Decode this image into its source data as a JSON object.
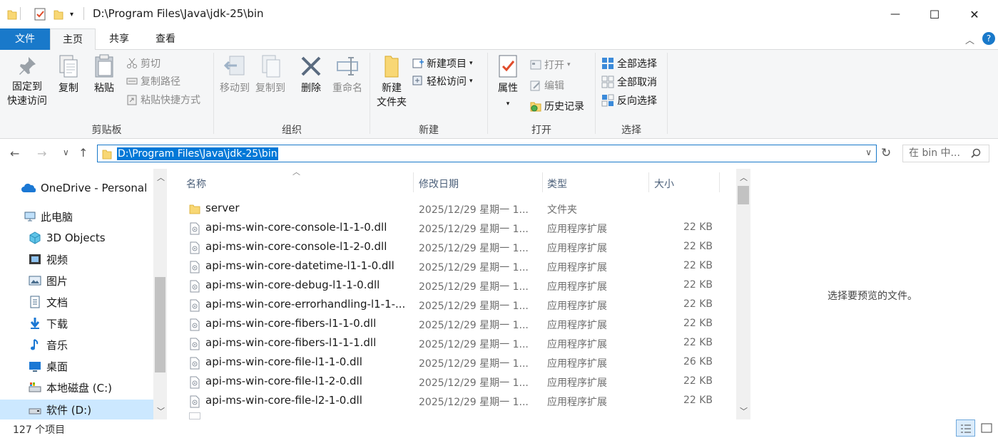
{
  "window": {
    "title": "D:\\Program Files\\Java\\jdk-25\\bin",
    "minimize": "—",
    "maximize": "☐",
    "close": "✕"
  },
  "tabs": {
    "file": "文件",
    "home": "主页",
    "share": "共享",
    "view": "查看"
  },
  "ribbon": {
    "clipboard": {
      "label": "剪贴板",
      "pin": "固定到\n快速访问",
      "pin_line1": "固定到",
      "pin_line2": "快速访问",
      "copy": "复制",
      "paste": "粘贴",
      "cut": "剪切",
      "copy_path": "复制路径",
      "paste_shortcut": "粘贴快捷方式"
    },
    "organize": {
      "label": "组织",
      "move_to": "移动到",
      "copy_to": "复制到",
      "delete": "删除",
      "rename": "重命名"
    },
    "new": {
      "label": "新建",
      "new_folder_line1": "新建",
      "new_folder_line2": "文件夹",
      "new_item": "新建项目",
      "easy_access": "轻松访问"
    },
    "open": {
      "label": "打开",
      "properties": "属性",
      "open": "打开",
      "edit": "编辑",
      "history": "历史记录"
    },
    "select": {
      "label": "选择",
      "select_all": "全部选择",
      "select_none": "全部取消",
      "invert": "反向选择"
    }
  },
  "address": {
    "path": "D:\\Program Files\\Java\\jdk-25\\bin",
    "search_placeholder": "在 bin 中..."
  },
  "sidebar": {
    "items": [
      {
        "label": "OneDrive - Personal",
        "icon": "onedrive-icon"
      },
      {
        "label": "此电脑",
        "icon": "computer-icon"
      },
      {
        "label": "3D Objects",
        "icon": "3d-objects-icon"
      },
      {
        "label": "视频",
        "icon": "video-icon"
      },
      {
        "label": "图片",
        "icon": "pictures-icon"
      },
      {
        "label": "文档",
        "icon": "documents-icon"
      },
      {
        "label": "下载",
        "icon": "download-icon"
      },
      {
        "label": "音乐",
        "icon": "music-icon"
      },
      {
        "label": "桌面",
        "icon": "desktop-icon"
      },
      {
        "label": "本地磁盘 (C:)",
        "icon": "drive-c-icon"
      },
      {
        "label": "软件 (D:)",
        "icon": "drive-d-icon"
      }
    ]
  },
  "columns": {
    "name": "名称",
    "date": "修改日期",
    "type": "类型",
    "size": "大小"
  },
  "files": [
    {
      "name": "server",
      "date": "2025/12/29 星期一 1...",
      "type": "文件夹",
      "size": "",
      "kind": "folder"
    },
    {
      "name": "api-ms-win-core-console-l1-1-0.dll",
      "date": "2025/12/29 星期一 1...",
      "type": "应用程序扩展",
      "size": "22 KB",
      "kind": "dll"
    },
    {
      "name": "api-ms-win-core-console-l1-2-0.dll",
      "date": "2025/12/29 星期一 1...",
      "type": "应用程序扩展",
      "size": "22 KB",
      "kind": "dll"
    },
    {
      "name": "api-ms-win-core-datetime-l1-1-0.dll",
      "date": "2025/12/29 星期一 1...",
      "type": "应用程序扩展",
      "size": "22 KB",
      "kind": "dll"
    },
    {
      "name": "api-ms-win-core-debug-l1-1-0.dll",
      "date": "2025/12/29 星期一 1...",
      "type": "应用程序扩展",
      "size": "22 KB",
      "kind": "dll"
    },
    {
      "name": "api-ms-win-core-errorhandling-l1-1-...",
      "date": "2025/12/29 星期一 1...",
      "type": "应用程序扩展",
      "size": "22 KB",
      "kind": "dll"
    },
    {
      "name": "api-ms-win-core-fibers-l1-1-0.dll",
      "date": "2025/12/29 星期一 1...",
      "type": "应用程序扩展",
      "size": "22 KB",
      "kind": "dll"
    },
    {
      "name": "api-ms-win-core-fibers-l1-1-1.dll",
      "date": "2025/12/29 星期一 1...",
      "type": "应用程序扩展",
      "size": "22 KB",
      "kind": "dll"
    },
    {
      "name": "api-ms-win-core-file-l1-1-0.dll",
      "date": "2025/12/29 星期一 1...",
      "type": "应用程序扩展",
      "size": "26 KB",
      "kind": "dll"
    },
    {
      "name": "api-ms-win-core-file-l1-2-0.dll",
      "date": "2025/12/29 星期一 1...",
      "type": "应用程序扩展",
      "size": "22 KB",
      "kind": "dll"
    },
    {
      "name": "api-ms-win-core-file-l2-1-0.dll",
      "date": "2025/12/29 星期一 1...",
      "type": "应用程序扩展",
      "size": "22 KB",
      "kind": "dll"
    }
  ],
  "preview": {
    "empty_text": "选择要预览的文件。"
  },
  "status": {
    "count": "127 个项目"
  },
  "colors": {
    "accent": "#1979ca",
    "selection": "#0078d7",
    "folder": "#f8d775"
  }
}
